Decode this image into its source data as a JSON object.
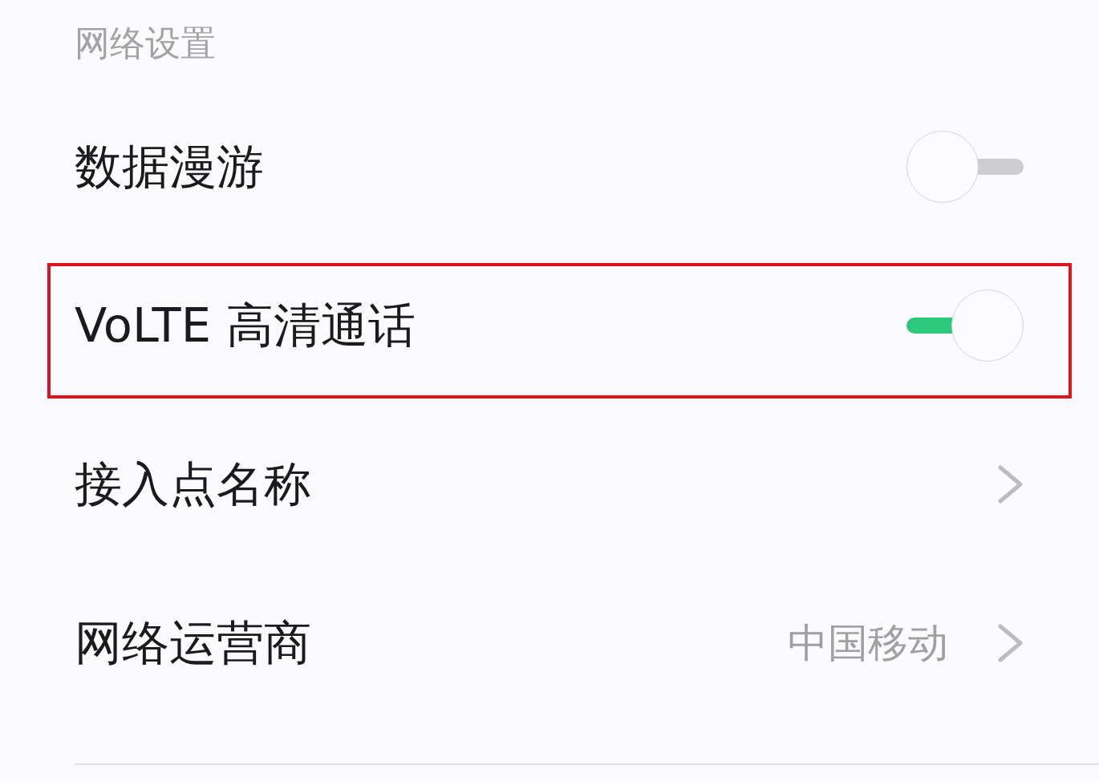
{
  "section_title": "网络设置",
  "rows": [
    {
      "kind": "toggle",
      "label": "数据漫游",
      "on": false,
      "highlighted": false
    },
    {
      "kind": "toggle",
      "label": "VoLTE 高清通话",
      "on": true,
      "highlighted": true
    },
    {
      "kind": "link",
      "label": "接入点名称",
      "highlighted": false
    },
    {
      "kind": "link",
      "label": "网络运营商",
      "value": "中国移动",
      "highlighted": false
    }
  ]
}
